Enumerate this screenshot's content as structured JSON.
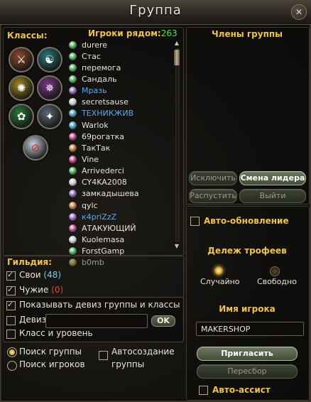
{
  "window": {
    "title": "Группа",
    "close_glyph": "✕"
  },
  "classes": {
    "label": "Классы:",
    "icons": [
      {
        "name": "warrior-class-icon",
        "color": "#8a4a32",
        "glyph": "⚔"
      },
      {
        "name": "mage-class-icon",
        "color": "#2a7a7a",
        "glyph": "☯"
      },
      {
        "name": "priest-class-icon",
        "color": "#9a8a2a",
        "glyph": "✺"
      },
      {
        "name": "warlock-class-icon",
        "color": "#7a3a8a",
        "glyph": "✵"
      },
      {
        "name": "druid-class-icon",
        "color": "#2a7a3a",
        "glyph": "✿"
      },
      {
        "name": "rogue-class-icon",
        "color": "#5a6a7a",
        "glyph": "✦"
      },
      {
        "name": "no-class-filter-icon",
        "color": "#c8d4e0",
        "glyph": "⊘"
      }
    ]
  },
  "nearby": {
    "label": "Игроки рядом:",
    "count": "263",
    "players": [
      {
        "name": "durere",
        "color": "#e9e4d8",
        "icon_color": "#4fa85a"
      },
      {
        "name": "Стас",
        "color": "#e9e4d8",
        "icon_color": "#4fa85a"
      },
      {
        "name": "перемога",
        "color": "#e9e4d8",
        "icon_color": "#4fa85a"
      },
      {
        "name": "Сандаль",
        "color": "#e9e4d8",
        "icon_color": "#4fa85a"
      },
      {
        "name": "Мразь",
        "color": "#5fa8e8",
        "icon_color": "#8a6ab8"
      },
      {
        "name": "secretsause",
        "color": "#e9e4d8",
        "icon_color": "#c8c8c8"
      },
      {
        "name": "ТЕХНИКЖИВ",
        "color": "#5fa8e8",
        "icon_color": "#4a9ab8"
      },
      {
        "name": "Warlok",
        "color": "#e9e4d8",
        "icon_color": "#4a9ab8"
      },
      {
        "name": "69рогатка",
        "color": "#e9e4d8",
        "icon_color": "#b84a8a"
      },
      {
        "name": "ТакТак",
        "color": "#e9e4d8",
        "icon_color": "#b87a4a"
      },
      {
        "name": "Vine",
        "color": "#e9e4d8",
        "icon_color": "#b84a8a"
      },
      {
        "name": "Arrivederci",
        "color": "#e9e4d8",
        "icon_color": "#4fa85a"
      },
      {
        "name": "CY4KA2008",
        "color": "#e9e4d8",
        "icon_color": "#c8c8c8"
      },
      {
        "name": "замкадышева",
        "color": "#e9e4d8",
        "icon_color": "#8a6ab8"
      },
      {
        "name": "qylc",
        "color": "#e9e4d8",
        "icon_color": "#b87a4a"
      },
      {
        "name": "к4priZzZ",
        "color": "#5fa8e8",
        "icon_color": "#8a6ab8"
      },
      {
        "name": "АТАКУЮЩИЙ",
        "color": "#e9e4d8",
        "icon_color": "#b84a8a"
      },
      {
        "name": "Kuolemasa",
        "color": "#e9e4d8",
        "icon_color": "#c8c8c8"
      },
      {
        "name": "ForstGamp",
        "color": "#e9e4d8",
        "icon_color": "#4fa85a"
      },
      {
        "name": "b0mb",
        "color": "#e9e4d8",
        "icon_color": "#b8a84a"
      }
    ]
  },
  "guild": {
    "label": "Гильдия:",
    "own_label": "Свои",
    "own_count": "(48)",
    "own_color": "#5fd8e8",
    "others_label": "Чужие",
    "others_count": "(0)",
    "others_color": "#e04a3a",
    "show_motto_label": "Показывать девиз группы и классы",
    "motto_label": "Девиз",
    "motto_value": "",
    "ok_label": "OK",
    "class_level_label": "Класс и уровень"
  },
  "search": {
    "group_label": "Поиск группы",
    "players_label": "Поиск игроков",
    "autocreate_label_1": "Автосоздание",
    "autocreate_label_2": "группы"
  },
  "members": {
    "label": "Члены группы",
    "kick_label": "Исключить",
    "leader_label": "Смена лидера",
    "disband_label": "Распустить",
    "leave_label": "Выйти",
    "autoupdate_label": "Авто-обновление"
  },
  "loot": {
    "label": "Дележ трофеев",
    "random_label": "Случайно",
    "free_label": "Свободно"
  },
  "player_name": {
    "label": "Имя игрока",
    "value": "MAKERSHOP",
    "invite_label": "Пригласить",
    "reroll_label": "Пересбор",
    "autoassist_label": "Авто-ассист"
  }
}
